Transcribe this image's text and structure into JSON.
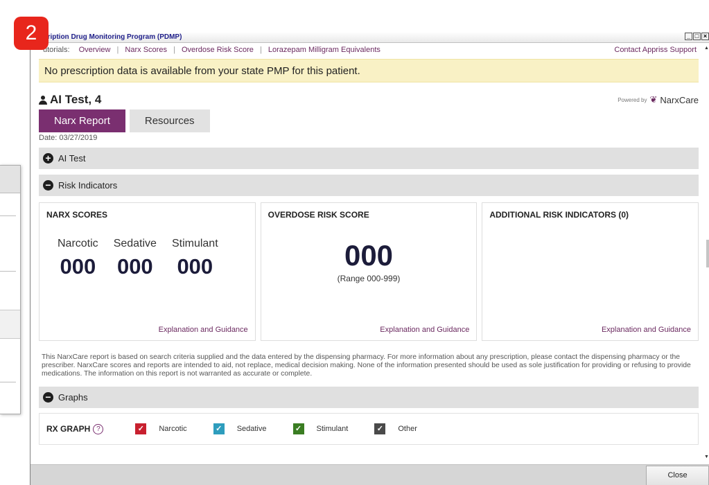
{
  "badge": "2",
  "window": {
    "title": "cription Drug Monitoring Program (PDMP)"
  },
  "window_controls": {
    "minimize": "_",
    "maximize": "□",
    "close": "×"
  },
  "tutorials": {
    "label": "utorials:",
    "links": [
      "Overview",
      "Narx Scores",
      "Overdose Risk Score",
      "Lorazepam Milligram Equivalents"
    ],
    "separator": "|",
    "support": "Contact Appriss Support"
  },
  "alert": "No prescription data is available from your state PMP for this patient.",
  "patient": {
    "name": "AI Test, 4"
  },
  "powered_by": {
    "label": "Powered by",
    "brand": "NarxCare"
  },
  "tabs": [
    {
      "label": "Narx Report"
    },
    {
      "label": "Resources"
    }
  ],
  "date": "Date: 03/27/2019",
  "sections": {
    "patient": {
      "label": "AI Test",
      "icon": "+"
    },
    "risk": {
      "label": "Risk Indicators",
      "icon": "−"
    },
    "graphs": {
      "label": "Graphs",
      "icon": "−"
    }
  },
  "narx": {
    "title": "NARX SCORES",
    "scores": [
      {
        "label": "Narcotic",
        "value": "000"
      },
      {
        "label": "Sedative",
        "value": "000"
      },
      {
        "label": "Stimulant",
        "value": "000"
      }
    ],
    "guidance": "Explanation and Guidance"
  },
  "overdose": {
    "title": "OVERDOSE RISK SCORE",
    "value": "000",
    "range": "(Range 000-999)",
    "guidance": "Explanation and Guidance"
  },
  "additional": {
    "title": "ADDITIONAL RISK INDICATORS (0)",
    "guidance": "Explanation and Guidance"
  },
  "disclaimer": "This NarxCare report is based on search criteria supplied and the data entered by the dispensing pharmacy. For more information about any prescription, please contact the dispensing pharmacy or the prescriber. NarxCare scores and reports are intended to aid, not replace, medical decision making. None of the information presented should be used as sole justification for providing or refusing to provide medications. The information on this report is not warranted as accurate or complete.",
  "rx_graph": {
    "title": "RX GRAPH",
    "legend": [
      {
        "label": "Narcotic",
        "color": "#c8202f"
      },
      {
        "label": "Sedative",
        "color": "#2e9dbd"
      },
      {
        "label": "Stimulant",
        "color": "#3a7d22"
      },
      {
        "label": "Other",
        "color": "#4a4a4a"
      }
    ]
  },
  "footer": {
    "close": "Close"
  }
}
